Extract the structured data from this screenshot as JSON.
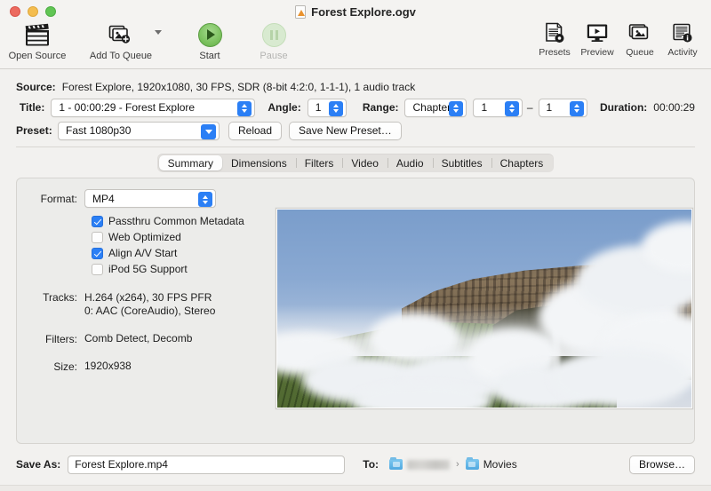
{
  "window": {
    "title": "Forest Explore.ogv",
    "doc_icon": "video-file-icon",
    "traffic_lights": [
      "close-button",
      "minimize-button",
      "zoom-button"
    ]
  },
  "toolbar": {
    "left_items": [
      {
        "label": "Open Source",
        "icon": "clapperboard-icon",
        "enabled": true
      },
      {
        "label": "Add To Queue",
        "icon": "add-to-queue-icon",
        "enabled": true,
        "has_menu": true
      },
      {
        "label": "Start",
        "icon": "play-icon",
        "enabled": true
      },
      {
        "label": "Pause",
        "icon": "pause-icon",
        "enabled": false
      }
    ],
    "right_items": [
      {
        "label": "Presets",
        "icon": "presets-icon"
      },
      {
        "label": "Preview",
        "icon": "preview-monitor-icon"
      },
      {
        "label": "Queue",
        "icon": "queue-stack-icon"
      },
      {
        "label": "Activity",
        "icon": "activity-log-icon"
      }
    ]
  },
  "source": {
    "label": "Source:",
    "value": "Forest Explore, 1920x1080, 30 FPS, SDR (8-bit 4:2:0, 1-1-1), 1 audio track"
  },
  "title_row": {
    "label": "Title:",
    "value": "1 - 00:00:29 - Forest Explore",
    "angle_label": "Angle:",
    "angle_value": "1",
    "range_label": "Range:",
    "range_value": "Chapters",
    "range_start": "1",
    "range_dash": "–",
    "range_end": "1",
    "duration_label": "Duration:",
    "duration_value": "00:00:29"
  },
  "preset_row": {
    "label": "Preset:",
    "value": "Fast 1080p30",
    "reload_label": "Reload",
    "save_label": "Save New Preset…"
  },
  "tabs": [
    {
      "label": "Summary",
      "active": true
    },
    {
      "label": "Dimensions",
      "active": false
    },
    {
      "label": "Filters",
      "active": false
    },
    {
      "label": "Video",
      "active": false
    },
    {
      "label": "Audio",
      "active": false
    },
    {
      "label": "Subtitles",
      "active": false
    },
    {
      "label": "Chapters",
      "active": false
    }
  ],
  "summary": {
    "format_label": "Format:",
    "format_value": "MP4",
    "checkboxes": [
      {
        "label": "Passthru Common Metadata",
        "checked": true
      },
      {
        "label": "Web Optimized",
        "checked": false
      },
      {
        "label": "Align A/V Start",
        "checked": true
      },
      {
        "label": "iPod 5G Support",
        "checked": false
      }
    ],
    "tracks_label": "Tracks:",
    "tracks_line1": "H.264 (x264), 30 FPS PFR",
    "tracks_line2": "0: AAC (CoreAudio), Stereo",
    "filters_label": "Filters:",
    "filters_value": "Comb Detect, Decomb",
    "size_label": "Size:",
    "size_value": "1920x938",
    "preview_alt": "video-preview-still"
  },
  "bottom": {
    "save_as_label": "Save As:",
    "save_as_value": "Forest Explore.mp4",
    "to_label": "To:",
    "crumb_volume": "",
    "crumb_sep": "›",
    "crumb_folder": "Movies",
    "browse_label": "Browse…"
  },
  "colors": {
    "accent": "#2b7ff5",
    "window_bg": "#f2f1ef",
    "panel_bg": "#ececea",
    "start_green": "#7cc25f",
    "traffic_red": "#ec6a5f",
    "traffic_yellow": "#f4bd4f",
    "traffic_green": "#61c554"
  }
}
